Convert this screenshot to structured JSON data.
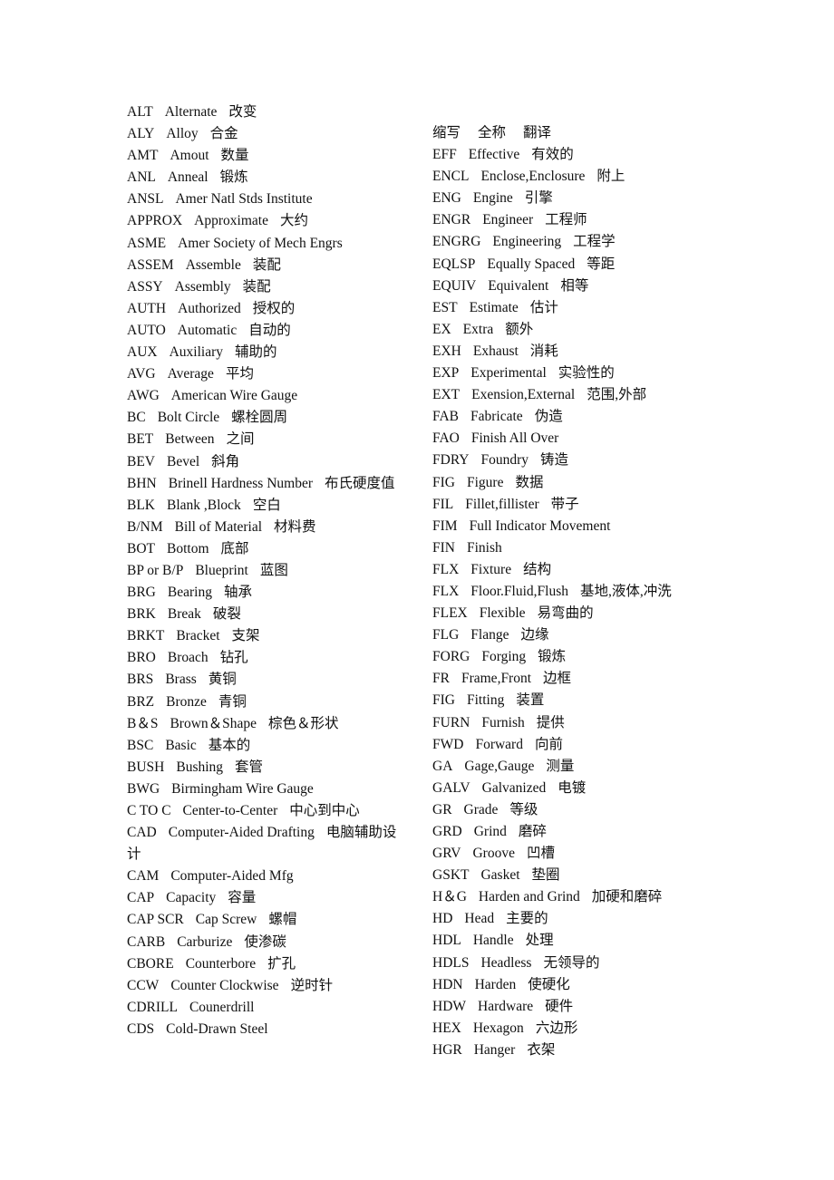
{
  "left_column": [
    [
      "ALT",
      "Alternate",
      "改变"
    ],
    [
      "ALY",
      "Alloy",
      "合金"
    ],
    [
      "AMT",
      "Amout",
      "数量"
    ],
    [
      "ANL",
      "Anneal",
      "锻炼"
    ],
    [
      "ANSL",
      "Amer Natl Stds Institute",
      ""
    ],
    [
      "APPROX",
      "Approximate",
      "大约"
    ],
    [
      "ASME",
      "Amer Society of Mech Engrs",
      ""
    ],
    [
      "ASSEM",
      "Assemble",
      "装配"
    ],
    [
      "ASSY",
      "Assembly",
      "装配"
    ],
    [
      "AUTH",
      "Authorized",
      "授权的"
    ],
    [
      "AUTO",
      "Automatic",
      "自动的"
    ],
    [
      "AUX",
      "Auxiliary",
      "辅助的"
    ],
    [
      "AVG",
      "Average",
      "平均"
    ],
    [
      "AWG",
      "American Wire Gauge",
      ""
    ],
    [
      "BC",
      "Bolt Circle",
      "螺栓圆周"
    ],
    [
      "BET",
      "Between",
      "之间"
    ],
    [
      "BEV",
      "Bevel",
      "斜角"
    ],
    [
      "BHN",
      "Brinell Hardness Number",
      "布氏硬度值"
    ],
    [
      "BLK",
      "Blank ,Block",
      "空白"
    ],
    [
      "B/NM",
      "Bill of Material",
      "材料费"
    ],
    [
      "BOT",
      "Bottom",
      "底部"
    ],
    [
      "BP or B/P",
      "Blueprint",
      "蓝图"
    ],
    [
      "BRG",
      "Bearing",
      "轴承"
    ],
    [
      "BRK",
      "Break",
      "破裂"
    ],
    [
      "BRKT",
      "Bracket",
      "支架"
    ],
    [
      "BRO",
      "Broach",
      "钻孔"
    ],
    [
      "BRS",
      "Brass",
      "黄铜"
    ],
    [
      "BRZ",
      "Bronze",
      "青铜"
    ],
    [
      "B＆S",
      "Brown＆Shape",
      "棕色＆形状"
    ],
    [
      "BSC",
      "Basic",
      "基本的"
    ],
    [
      "BUSH",
      "Bushing",
      "套管"
    ],
    [
      "BWG",
      "Birmingham Wire Gauge",
      ""
    ],
    [
      "C TO C",
      "Center-to-Center",
      "中心到中心"
    ],
    [
      "CAD",
      "Computer-Aided Drafting",
      "电脑辅助设计"
    ],
    [
      "CAM",
      "Computer-Aided Mfg",
      ""
    ],
    [
      "CAP",
      "Capacity",
      "容量"
    ],
    [
      "CAP SCR",
      "Cap Screw",
      "螺帽"
    ],
    [
      "CARB",
      "Carburize",
      "使渗碳"
    ],
    [
      "CBORE",
      "Counterbore",
      "扩孔"
    ],
    [
      "CCW",
      "Counter Clockwise",
      "逆时针"
    ],
    [
      "CDRILL",
      "Counerdrill",
      ""
    ],
    [
      "CDS",
      "Cold-Drawn Steel",
      ""
    ]
  ],
  "right_column": {
    "header": [
      "缩写",
      "全称",
      "翻译"
    ],
    "entries": [
      [
        "EFF",
        "Effective",
        "有效的"
      ],
      [
        "ENCL",
        "Enclose,Enclosure",
        "附上"
      ],
      [
        "ENG",
        "Engine",
        "引擎"
      ],
      [
        "ENGR",
        "Engineer",
        "工程师"
      ],
      [
        "ENGRG",
        "Engineering",
        "工程学"
      ],
      [
        "EQLSP",
        "Equally Spaced",
        "等距"
      ],
      [
        "EQUIV",
        "Equivalent",
        "相等"
      ],
      [
        "EST",
        "Estimate",
        "估计"
      ],
      [
        "EX",
        "Extra",
        "额外"
      ],
      [
        "EXH",
        "Exhaust",
        "消耗"
      ],
      [
        "EXP",
        "Experimental",
        "实验性的"
      ],
      [
        "EXT",
        "Exension,External",
        "范围,外部"
      ],
      [
        "FAB",
        "Fabricate",
        "伪造"
      ],
      [
        "FAO",
        "Finish All Over",
        ""
      ],
      [
        "FDRY",
        "Foundry",
        "铸造"
      ],
      [
        "FIG",
        "Figure",
        "数据"
      ],
      [
        "FIL",
        "Fillet,fillister",
        "带子"
      ],
      [
        "FIM",
        "Full Indicator Movement",
        ""
      ],
      [
        "FIN",
        "Finish",
        ""
      ],
      [
        "FLX",
        "Fixture",
        "结构"
      ],
      [
        "FLX",
        "Floor.Fluid,Flush",
        "基地,液体,冲洗"
      ],
      [
        "FLEX",
        "Flexible",
        "易弯曲的"
      ],
      [
        "FLG",
        "Flange",
        "边缘"
      ],
      [
        "FORG",
        "Forging",
        "锻炼"
      ],
      [
        "FR",
        "Frame,Front",
        "边框"
      ],
      [
        "FIG",
        "Fitting",
        "装置"
      ],
      [
        "FURN",
        "Furnish",
        "提供"
      ],
      [
        "FWD",
        "Forward",
        "向前"
      ],
      [
        "GA",
        "Gage,Gauge",
        "测量"
      ],
      [
        "GALV",
        "Galvanized",
        "电镀"
      ],
      [
        "GR",
        "Grade",
        "等级"
      ],
      [
        "GRD",
        "Grind",
        "磨碎"
      ],
      [
        "GRV",
        "Groove",
        "凹槽"
      ],
      [
        "GSKT",
        "Gasket",
        "垫圈"
      ],
      [
        "H＆G",
        "Harden and Grind",
        "加硬和磨碎"
      ],
      [
        "HD",
        "Head",
        "主要的"
      ],
      [
        "HDL",
        "Handle",
        "处理"
      ],
      [
        "HDLS",
        "Headless",
        "无领导的"
      ],
      [
        "HDN",
        "Harden",
        "使硬化"
      ],
      [
        "HDW",
        "Hardware",
        "硬件"
      ],
      [
        "HEX",
        "Hexagon",
        "六边形"
      ],
      [
        "HGR",
        "Hanger",
        "衣架"
      ]
    ]
  }
}
